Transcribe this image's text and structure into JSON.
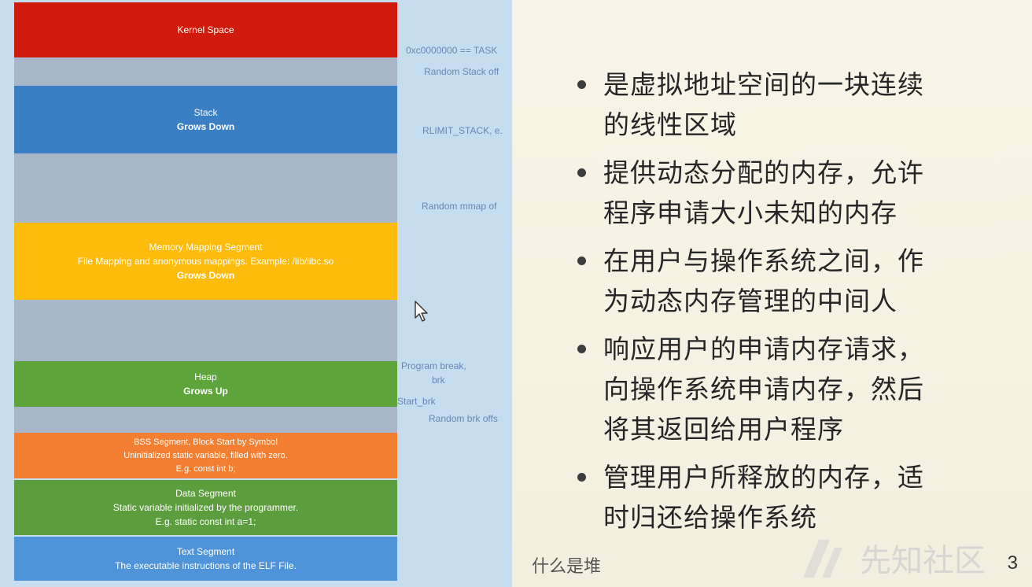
{
  "diagram": {
    "kernel": {
      "label": "Kernel Space"
    },
    "stack": {
      "label": "Stack",
      "sub": "Grows Down"
    },
    "mmap": {
      "label": "Memory Mapping Segment",
      "desc": "File Mapping and anonymous mappings. Example: /lib/libc.so",
      "sub": "Grows Down"
    },
    "heap": {
      "label": "Heap",
      "sub": "Grows Up"
    },
    "bss": {
      "label": "BSS Segment, Block Start by Symbol",
      "desc": "Uninitialized static variable, filled with zero.",
      "example": "E.g. const int b;"
    },
    "data": {
      "label": "Data Segment",
      "desc": "Static variable initialized by the programmer.",
      "example": "E.g. static const int a=1;"
    },
    "text": {
      "label": "Text Segment",
      "desc": "The executable instructions of the ELF File."
    },
    "addresses": {
      "task_size": "0xc0000000 == TASK",
      "random_stack": "Random Stack off",
      "rlimit_stack": "RLIMIT_STACK, e.",
      "random_mmap": "Random mmap of",
      "program_break": "Program break,",
      "brk": "brk",
      "start_brk": "Start_brk",
      "random_brk": "Random brk offs"
    },
    "colors": {
      "kernel": "#d01a0c",
      "stack": "#3a7fc3",
      "mmap": "#fdbb0c",
      "heap": "#5da43b",
      "bss": "#f37f32",
      "data": "#5c9e3d",
      "text": "#4f94d8",
      "gap": "#a9b6c9",
      "panel": "#c6dcef"
    }
  },
  "slide": {
    "bullets": [
      "是虚拟地址空间的一块连续的线性区域",
      "提供动态分配的内存，允许程序申请大小未知的内存",
      "在用户与操作系统之间，作为动态内存管理的中间人",
      "响应用户的申请内存请求，向操作系统申请内存，然后将其返回给用户程序",
      "管理用户所释放的内存，适时归还给操作系统"
    ],
    "footer_title": "什么是堆",
    "page_number": "3",
    "watermark": "先知社区"
  }
}
